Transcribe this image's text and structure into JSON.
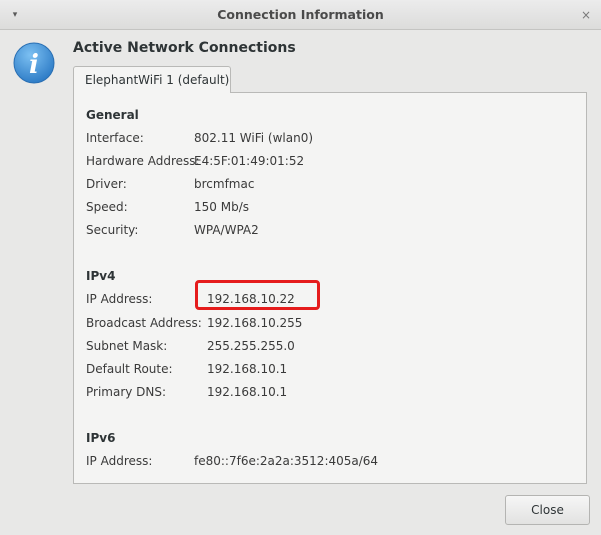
{
  "window": {
    "title": "Connection Information",
    "menu_glyph": "▾",
    "close_glyph": "×"
  },
  "header": {
    "icon": "info-icon",
    "title": "Active Network Connections"
  },
  "tabs": [
    {
      "label": "ElephantWiFi 1 (default)"
    }
  ],
  "sections": {
    "general": {
      "title": "General",
      "rows": [
        {
          "label": "Interface:",
          "value": "802.11 WiFi (wlan0)"
        },
        {
          "label": "Hardware Address:",
          "value": "E4:5F:01:49:01:52"
        },
        {
          "label": "Driver:",
          "value": "brcmfmac"
        },
        {
          "label": "Speed:",
          "value": "150 Mb/s"
        },
        {
          "label": "Security:",
          "value": "WPA/WPA2"
        }
      ]
    },
    "ipv4": {
      "title": "IPv4",
      "rows": [
        {
          "label": "IP Address:",
          "value": "192.168.10.22"
        },
        {
          "label": "Broadcast Address:",
          "value": "192.168.10.255"
        },
        {
          "label": "Subnet Mask:",
          "value": "255.255.255.0"
        },
        {
          "label": "Default Route:",
          "value": "192.168.10.1"
        },
        {
          "label": "Primary DNS:",
          "value": "192.168.10.1"
        }
      ]
    },
    "ipv6": {
      "title": "IPv6",
      "rows": [
        {
          "label": "IP Address:",
          "value": "fe80::7f6e:2a2a:3512:405a/64"
        }
      ]
    }
  },
  "footer": {
    "close_label": "Close"
  },
  "colors": {
    "highlight": "#e51c1c",
    "info_icon": "#3d8fd6"
  }
}
